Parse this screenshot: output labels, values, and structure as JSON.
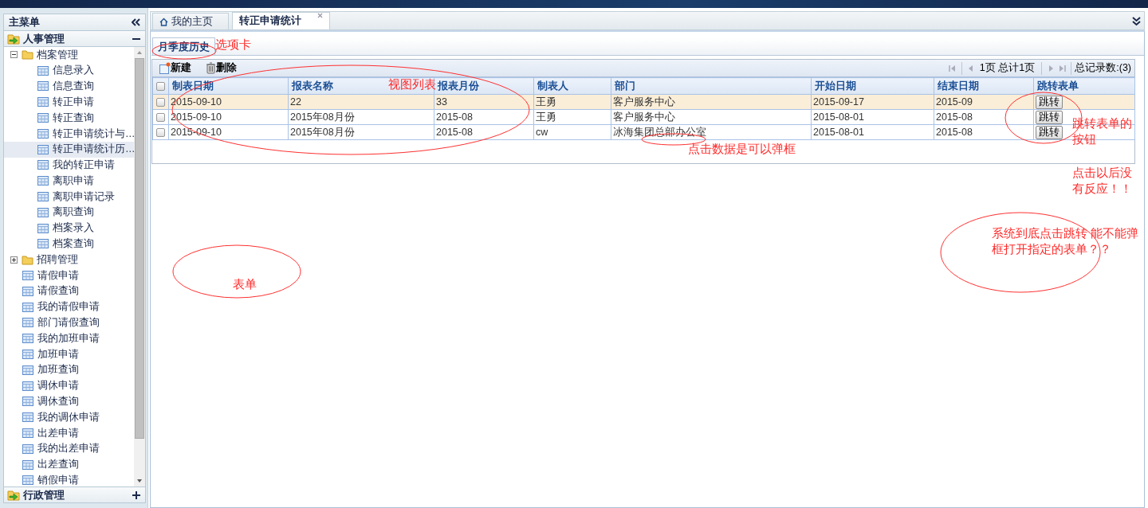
{
  "sidebar": {
    "title": "主菜单",
    "groups": [
      {
        "label": "人事管理",
        "expanded": true,
        "items": [
          {
            "label": "档案管理",
            "kind": "folder",
            "expanded": true,
            "selected": false,
            "children": [
              {
                "label": "信息录入",
                "selected": false
              },
              {
                "label": "信息查询",
                "selected": false
              },
              {
                "label": "转正申请",
                "selected": false
              },
              {
                "label": "转正查询",
                "selected": false
              },
              {
                "label": "转正申请统计与…",
                "selected": false
              },
              {
                "label": "转正申请统计历…",
                "selected": true
              },
              {
                "label": "我的转正申请",
                "selected": false
              },
              {
                "label": "离职申请",
                "selected": false
              },
              {
                "label": "离职申请记录",
                "selected": false
              },
              {
                "label": "离职查询",
                "selected": false
              },
              {
                "label": "档案录入",
                "selected": false
              },
              {
                "label": "档案查询",
                "selected": false
              }
            ]
          },
          {
            "label": "招聘管理",
            "kind": "folder",
            "expanded": false,
            "selected": false
          },
          {
            "label": "请假申请",
            "kind": "page",
            "selected": false
          },
          {
            "label": "请假查询",
            "kind": "page",
            "selected": false
          },
          {
            "label": "我的请假申请",
            "kind": "page",
            "selected": false
          },
          {
            "label": "部门请假查询",
            "kind": "page",
            "selected": false
          },
          {
            "label": "我的加班申请",
            "kind": "page",
            "selected": false
          },
          {
            "label": "加班申请",
            "kind": "page",
            "selected": false
          },
          {
            "label": "加班查询",
            "kind": "page",
            "selected": false
          },
          {
            "label": "调休申请",
            "kind": "page",
            "selected": false
          },
          {
            "label": "调休查询",
            "kind": "page",
            "selected": false
          },
          {
            "label": "我的调休申请",
            "kind": "page",
            "selected": false
          },
          {
            "label": "出差申请",
            "kind": "page",
            "selected": false
          },
          {
            "label": "我的出差申请",
            "kind": "page",
            "selected": false
          },
          {
            "label": "出差查询",
            "kind": "page",
            "selected": false
          },
          {
            "label": "销假申请",
            "kind": "page",
            "selected": false
          }
        ]
      },
      {
        "label": "行政管理",
        "expanded": false
      }
    ]
  },
  "tabs": [
    {
      "label": "我的主页",
      "kind": "home",
      "selected": false,
      "closable": false
    },
    {
      "label": "转正申请统计",
      "kind": "page",
      "selected": true,
      "closable": true
    }
  ],
  "subtabs": [
    {
      "label": "月季度历史",
      "selected": true
    }
  ],
  "toolbar": [
    {
      "label": "新建",
      "kind": "new"
    },
    {
      "label": "删除",
      "kind": "delete"
    }
  ],
  "pager": {
    "page_info": "1页 总计1页",
    "total": "总记录数:(3)"
  },
  "table": {
    "all_checked": false,
    "columns": [
      "制表日期",
      "报表名称",
      "报表月份",
      "制表人",
      "部门",
      "开始日期",
      "结束日期",
      "跳转表单"
    ],
    "rows": [
      {
        "selected": true,
        "checked": false,
        "cells": [
          "2015-09-10",
          "22",
          "33",
          "王勇",
          "客户服务中心",
          "2015-09-17",
          "2015-09"
        ],
        "action": "跳转"
      },
      {
        "selected": false,
        "checked": false,
        "cells": [
          "2015-09-10",
          "2015年08月份",
          "2015-08",
          "王勇",
          "客户服务中心",
          "2015-08-01",
          "2015-08"
        ],
        "action": "跳转"
      },
      {
        "selected": false,
        "checked": false,
        "cells": [
          "2015-09-10",
          "2015年08月份",
          "2015-08",
          "cw",
          "冰海集团总部办公室",
          "2015-08-01",
          "2015-08"
        ],
        "action": "跳转"
      }
    ]
  },
  "annotations": [
    {
      "text": "选项卡"
    },
    {
      "text": "视图列表"
    },
    {
      "text": "跳转表单的按钮"
    },
    {
      "text": "点击数据是可以弹框"
    },
    {
      "text": "点击以后没有反应！！"
    },
    {
      "text": "系统到底点击跳转 能不能弹框打开指定的表单？？"
    },
    {
      "text": "表单"
    }
  ]
}
